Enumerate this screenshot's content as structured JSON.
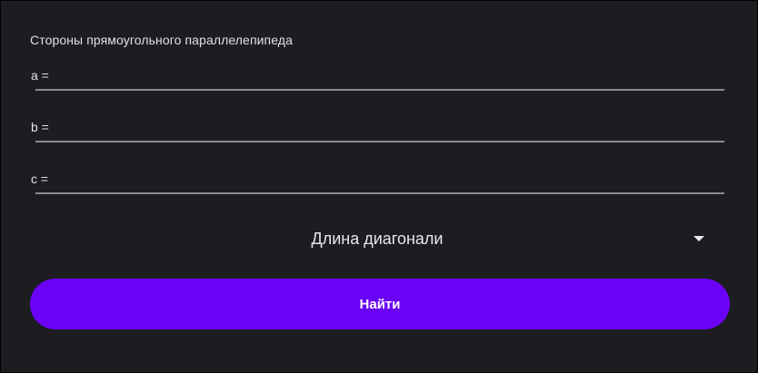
{
  "form": {
    "section_title": "Стороны прямоугольного параллелепипеда",
    "fields": [
      {
        "label": "a =",
        "value": ""
      },
      {
        "label": "b =",
        "value": ""
      },
      {
        "label": "c =",
        "value": ""
      }
    ]
  },
  "dropdown": {
    "selected": "Длина диагонали",
    "icon": "triangle-down"
  },
  "actions": {
    "find_label": "Найти"
  },
  "colors": {
    "background": "#1d1c21",
    "accent": "#6a03f6",
    "text": "#e2e0e6",
    "underline": "#8a8a8e"
  }
}
